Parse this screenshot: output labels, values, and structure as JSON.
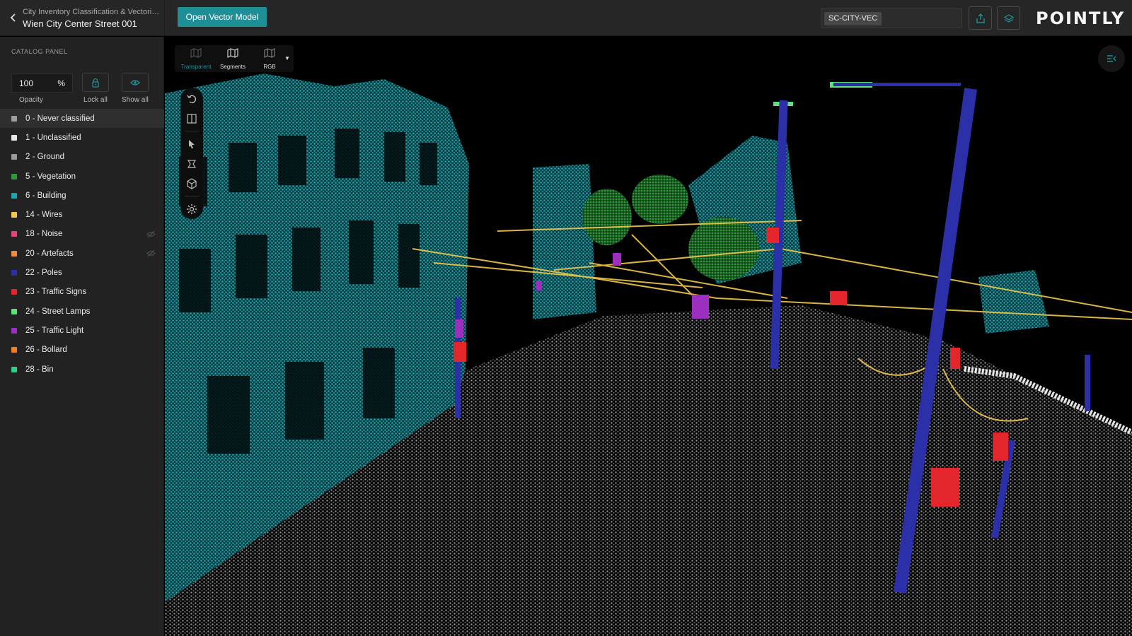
{
  "header": {
    "project_subtitle": "City Inventory Classification & Vectorization ...",
    "project_title": "Wien City Center Street 001",
    "open_vector_label": "Open Vector Model",
    "code_chip": "SC-CITY-VEC",
    "logo": "POINTLY"
  },
  "sidebar": {
    "title": "CATALOG PANEL",
    "opacity_value": "100",
    "opacity_unit": "%",
    "opacity_label": "Opacity",
    "lock_all_label": "Lock all",
    "show_all_label": "Show all",
    "classes": [
      {
        "label": "0 - Never classified",
        "color": "#9e9e9e",
        "hidden": false
      },
      {
        "label": "1 - Unclassified",
        "color": "#e6e6e6",
        "hidden": false
      },
      {
        "label": "2 - Ground",
        "color": "#9a9a9a",
        "hidden": false
      },
      {
        "label": "5 - Vegetation",
        "color": "#2f9a3a",
        "hidden": false
      },
      {
        "label": "6 - Building",
        "color": "#1fa3ac",
        "hidden": false
      },
      {
        "label": "14 - Wires",
        "color": "#f2c94c",
        "hidden": false
      },
      {
        "label": "18 - Noise",
        "color": "#e0457b",
        "hidden": true
      },
      {
        "label": "20 - Artefacts",
        "color": "#f08a3c",
        "hidden": true
      },
      {
        "label": "22 - Poles",
        "color": "#2b2fa8",
        "hidden": false
      },
      {
        "label": "23 - Traffic Signs",
        "color": "#e2262b",
        "hidden": false
      },
      {
        "label": "24 - Street Lamps",
        "color": "#5ee27a",
        "hidden": false
      },
      {
        "label": "25 - Traffic Light",
        "color": "#9b2fbf",
        "hidden": false
      },
      {
        "label": "26 - Bollard",
        "color": "#f07f2a",
        "hidden": false
      },
      {
        "label": "28 - Bin",
        "color": "#2fcf86",
        "hidden": false
      }
    ]
  },
  "viewport": {
    "view_modes": [
      {
        "label": "Transparent",
        "active": true
      },
      {
        "label": "Segments",
        "active": false
      },
      {
        "label": "RGB",
        "active": false
      }
    ]
  },
  "colors": {
    "accent": "#1f8f97",
    "building": "#1fa3ac",
    "ground": "#8a8a8a",
    "poles": "#2b2fa8",
    "wires": "#f2c94c",
    "signs": "#e2262b"
  }
}
